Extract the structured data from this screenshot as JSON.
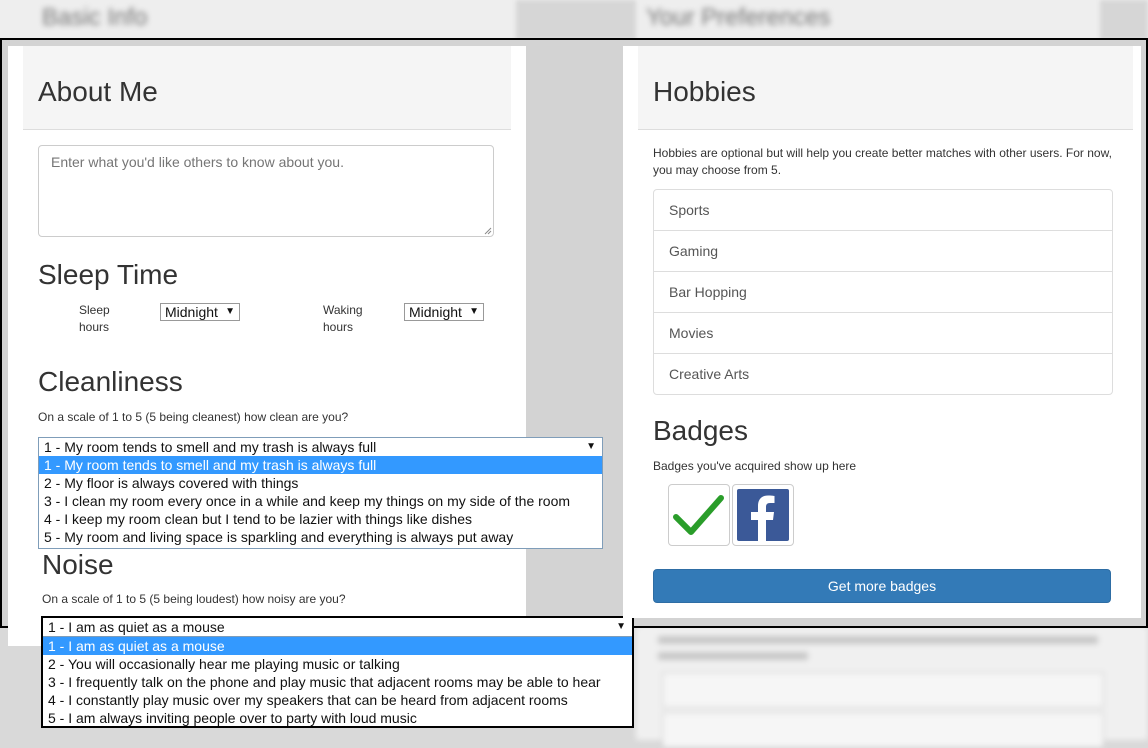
{
  "background_top": {
    "left_ghost_text": "Basic Info",
    "right_ghost_text": "Your Preferences"
  },
  "about": {
    "heading": "About Me",
    "placeholder": "Enter what you'd like others to know about you."
  },
  "sleep": {
    "heading": "Sleep Time",
    "sleep_label_1": "Sleep",
    "sleep_label_2": "hours",
    "sleep_value": "Midnight",
    "wake_label_1": "Waking",
    "wake_label_2": "hours",
    "wake_value": "Midnight"
  },
  "cleanliness": {
    "heading": "Cleanliness",
    "question": "On a scale of 1 to 5 (5 being cleanest) how clean are you?",
    "selected": "1 - My room tends to smell and my trash is always full",
    "options": [
      "1 - My room tends to smell and my trash is always full",
      "2 - My floor is always covered with things",
      "3 - I clean my room every once in a while and keep my things on my side of the room",
      "4 - I keep my room clean but I tend to be lazier with things like dishes",
      "5 - My room and living space is sparkling and everything is always put away"
    ],
    "highlighted_index": 0
  },
  "noise": {
    "heading": "Noise",
    "question": "On a scale of 1 to 5 (5 being loudest) how noisy are you?",
    "selected": "1 - I am as quiet as a mouse",
    "options": [
      "1 - I am as quiet as a mouse",
      "2 - You will occasionally hear me playing music or talking",
      "3 - I frequently talk on the phone and play music that adjacent rooms may be able to hear",
      "4 - I constantly play music over my speakers that can be heard from adjacent rooms",
      "5 - I am always inviting people over to party with loud music"
    ],
    "highlighted_index": 0
  },
  "hobbies": {
    "heading": "Hobbies",
    "description": "Hobbies are optional but will help you create better matches with other users. For now, you may choose from 5.",
    "items": [
      "Sports",
      "Gaming",
      "Bar Hopping",
      "Movies",
      "Creative Arts"
    ]
  },
  "badges": {
    "heading": "Badges",
    "description": "Badges you've acquired show up here",
    "icons": [
      "checkmark-badge-icon",
      "facebook-badge-icon"
    ],
    "button_label": "Get more badges"
  },
  "colors": {
    "primary_button": "#337ab7",
    "dropdown_highlight": "#3399ff",
    "checkmark": "#2a9d2a",
    "facebook": "#3b5998"
  }
}
